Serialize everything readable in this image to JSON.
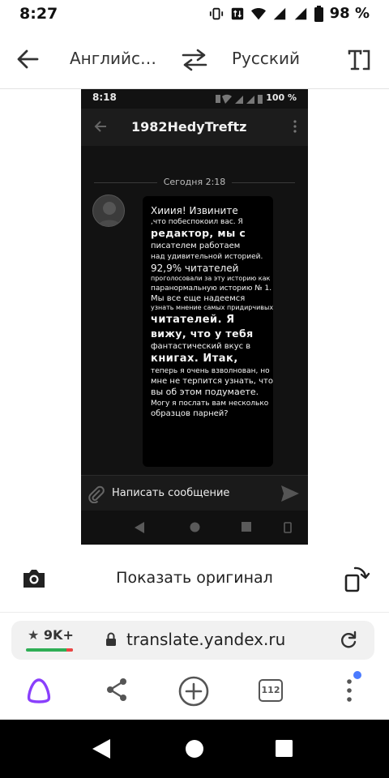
{
  "status_bar": {
    "time": "8:27",
    "battery_text": "98 %"
  },
  "translate_header": {
    "source_lang": "Английс…",
    "target_lang": "Русский"
  },
  "translated_screenshot": {
    "status_time": "8:18",
    "status_battery": "100 %",
    "chat_title": "1982HedyTreftz",
    "date_label": "Сегодня 2:18",
    "message_lines": [
      "Хииия! Извините",
      ",что побеспокоил вас. Я",
      "редактор, мы с",
      "писателем работаем",
      "над удивительной историей.",
      "92,9% читателей",
      "проголосовали за эту историю как",
      "паранормальную историю № 1.",
      "Мы все еще надеемся",
      "узнать мнение самых придирчивых",
      "читателей. Я",
      "вижу, что у тебя",
      "фантастический вкус в",
      "книгах. Итак,",
      "теперь я очень взволнован, но",
      "мне не терпится узнать, что",
      "вы об этом подумаете.",
      "Могу я послать вам несколько",
      "образцов парней?"
    ],
    "input_placeholder": "Написать сообщение"
  },
  "original_bar": {
    "show_original_label": "Показать оригинал"
  },
  "browser": {
    "rating": "9K+",
    "url": "translate.yandex.ru",
    "tabs_count": "112"
  },
  "colors": {
    "accent_purple": "#8a3ffc",
    "notification_blue": "#4b7bff",
    "rating_green": "#2fae55",
    "phone_bg": "#121212"
  },
  "icons": [
    "back-arrow-icon",
    "swap-icon",
    "text-mode-icon",
    "camera-icon",
    "rotate-icon",
    "star-icon",
    "lock-icon",
    "reload-icon",
    "alice-icon",
    "share-icon",
    "plus-circle-icon",
    "menu-dots-icon"
  ]
}
